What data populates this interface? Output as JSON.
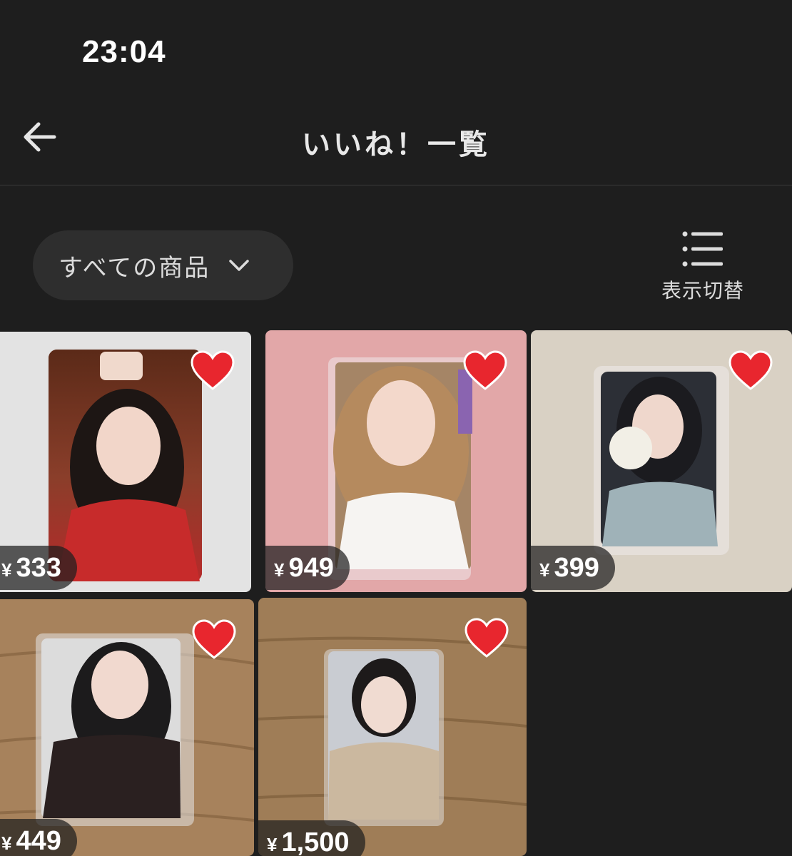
{
  "status_bar": {
    "time": "23:04"
  },
  "header": {
    "title": "いいね！一覧",
    "back_icon": "arrow-left-icon"
  },
  "filter": {
    "label": "すべての商品",
    "icon": "chevron-down-icon"
  },
  "view_toggle": {
    "label": "表示切替",
    "icon": "list-icon"
  },
  "currency_symbol": "¥",
  "colors": {
    "background": "#1e1e1e",
    "heart": "#e8262e",
    "pill": "#2e2e2e"
  },
  "items": [
    {
      "price": "333",
      "liked": true
    },
    {
      "price": "949",
      "liked": true
    },
    {
      "price": "399",
      "liked": true
    },
    {
      "price": "449",
      "liked": true
    },
    {
      "price": "1,500",
      "liked": true
    }
  ]
}
